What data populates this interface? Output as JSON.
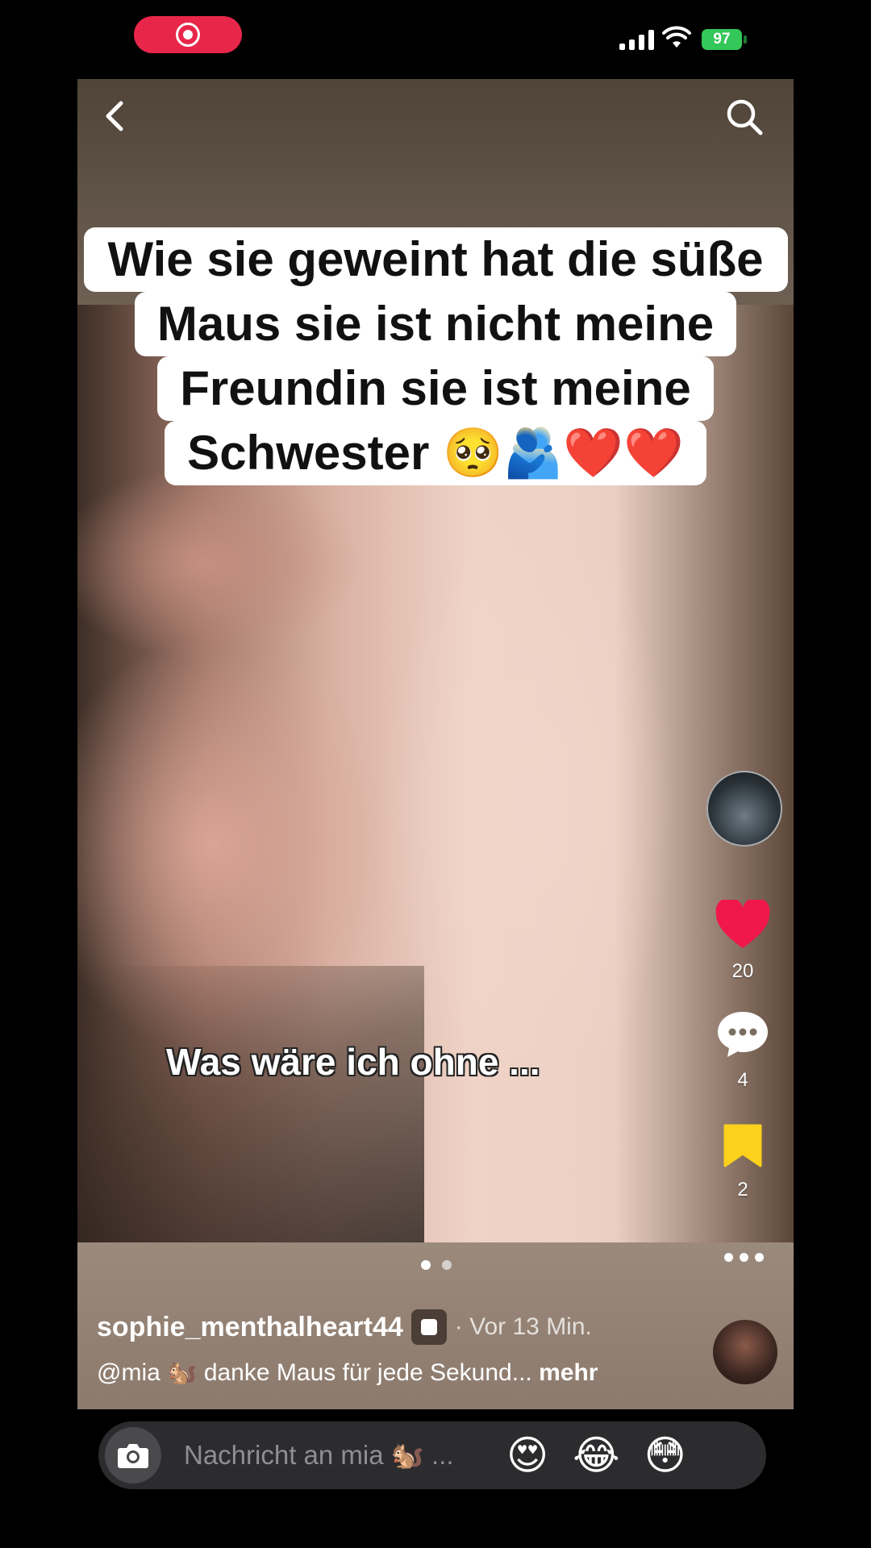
{
  "status_bar": {
    "battery": "97"
  },
  "caption_lines": [
    "Wie sie geweint hat die süße",
    "Maus sie ist nicht meine",
    "Freundin sie ist meine",
    "Schwester 🥺🫂❤️❤️"
  ],
  "overlay_text": "Was wäre ich ohne ...",
  "actions": {
    "likes": "20",
    "comments": "4",
    "saves": "2"
  },
  "post": {
    "author": "sophie_menthalheart44",
    "time": "· Vor 13 Min.",
    "description": "@mia 🐿️ danke Maus für jede Sekund...",
    "more": "mehr",
    "slide_count": 2,
    "active_slide": 1
  },
  "message_bar": {
    "placeholder": "Nachricht an mia 🐿️ ...",
    "quick_reactions": [
      "😍",
      "😂",
      "😳"
    ]
  },
  "colors": {
    "heart": "#f0174a",
    "bookmark": "#fbd11c",
    "record": "#e8264a"
  }
}
